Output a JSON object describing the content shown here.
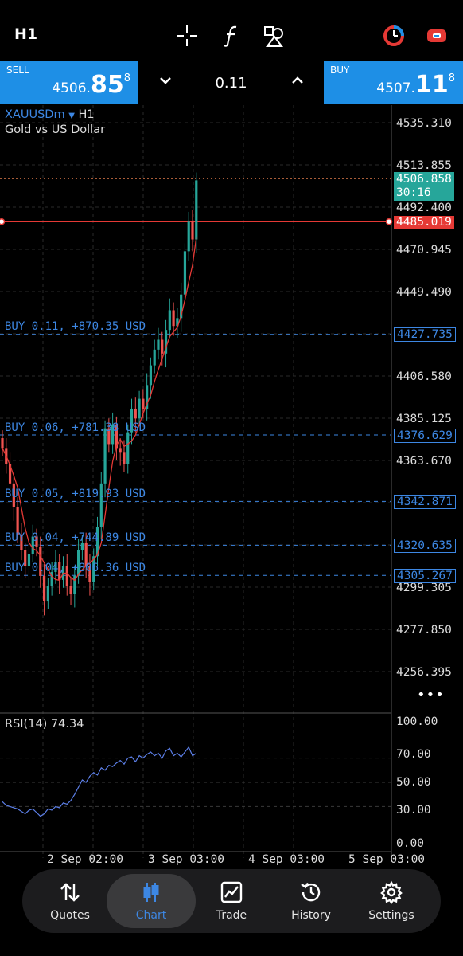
{
  "header": {
    "timeframe": "H1"
  },
  "trade": {
    "sell": {
      "label": "SELL",
      "price_small": "4506.",
      "price_big": "85",
      "price_sup": "8"
    },
    "buy": {
      "label": "BUY",
      "price_small": "4507.",
      "price_big": "11",
      "price_sup": "8"
    },
    "volume": "0.11"
  },
  "chart": {
    "symbol": "XAUUSDm",
    "timeframe": "H1",
    "description": "Gold vs US Dollar",
    "price_labels": [
      "4535.310",
      "4513.855",
      "4492.400",
      "4470.945",
      "4449.490",
      "4406.580",
      "4385.125",
      "4363.670",
      "4299.305",
      "4277.850",
      "4256.395"
    ],
    "current_price": "4506.858",
    "countdown": "30:16",
    "red_line_price": "4485.019",
    "positions": [
      {
        "text": "BUY 0.11, +870.35 USD",
        "price": "4427.735"
      },
      {
        "text": "BUY 0.06, +781.38 USD",
        "price": "4376.629"
      },
      {
        "text": "BUY 0.05, +819.93 USD",
        "price": "4342.871"
      },
      {
        "text": "BUY 0.04, +744.89 USD",
        "price": "4320.635"
      },
      {
        "text": "BUY 0.04, +806.36 USD",
        "price": "4305.267"
      }
    ],
    "more": "•••",
    "rsi": {
      "label": "RSI(14) 74.34",
      "levels": [
        "100.00",
        "70.00",
        "50.00",
        "30.00",
        "0.00"
      ]
    },
    "dates": [
      "2 Sep 02:00",
      "3 Sep 03:00",
      "4 Sep 03:00",
      "5 Sep 03:00"
    ],
    "colors": {
      "bull": "#26a69a",
      "bear": "#ef5350",
      "accent": "#1e8fe6",
      "red_line": "#e53935",
      "ma": "#e53935",
      "rsi": "#5c7fe8"
    }
  },
  "nav": {
    "items": [
      {
        "label": "Quotes",
        "icon": "quotes-icon"
      },
      {
        "label": "Chart",
        "icon": "chart-icon",
        "active": true
      },
      {
        "label": "Trade",
        "icon": "trade-icon"
      },
      {
        "label": "History",
        "icon": "history-icon"
      },
      {
        "label": "Settings",
        "icon": "settings-icon"
      }
    ]
  }
}
